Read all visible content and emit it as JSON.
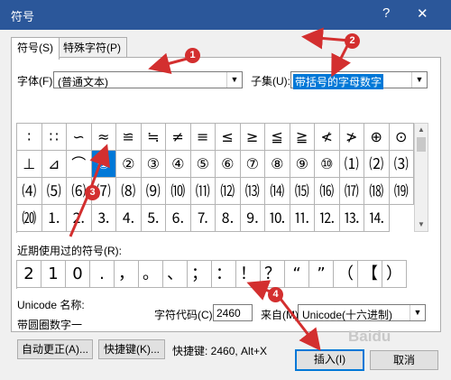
{
  "window": {
    "title": "符号",
    "help": "?",
    "close": "✕"
  },
  "tabs": [
    {
      "label": "符号(S)"
    },
    {
      "label": "特殊字符(P)"
    }
  ],
  "font": {
    "label": "字体(F):",
    "value": "(普通文本)"
  },
  "subset": {
    "label": "子集(U):",
    "value": "带括号的字母数字"
  },
  "symbols": [
    [
      "∶",
      "∷",
      "∽",
      "≈",
      "≌",
      "≒",
      "≠",
      "≡",
      "≤",
      "≥",
      "≦",
      "≧",
      "≮",
      "≯",
      "⊕",
      "⊙"
    ],
    [
      "⊥",
      "⊿",
      "⌒",
      "①",
      "②",
      "③",
      "④",
      "⑤",
      "⑥",
      "⑦",
      "⑧",
      "⑨",
      "⑩",
      "⑴",
      "⑵",
      "⑶"
    ],
    [
      "⑷",
      "⑸",
      "⑹",
      "⑺",
      "⑻",
      "⑼",
      "⑽",
      "⑾",
      "⑿",
      "⒀",
      "⒁",
      "⒂",
      "⒃",
      "⒄",
      "⒅",
      "⒆"
    ],
    [
      "⒇",
      "⒈",
      "⒉",
      "⒊",
      "⒋",
      "⒌",
      "⒍",
      "⒎",
      "⒏",
      "⒐",
      "⒑",
      "⒒",
      "⒓",
      "⒔",
      "⒕"
    ]
  ],
  "recent_label": "近期使用过的符号(R):",
  "recent_symbols": [
    "2",
    "1",
    "0",
    ".",
    "，",
    "。",
    "、",
    "；",
    "：",
    "！",
    "？",
    "“",
    "”",
    "（",
    "【",
    "）"
  ],
  "unicode_name_label": "Unicode 名称:",
  "unicode_name": "带圆圈数字一",
  "char_code_label": "字符代码(C):",
  "char_code": "2460",
  "from_label": "来自(M):",
  "from_value": "Unicode(十六进制)",
  "autocorrect_button": "自动更正(A)...",
  "shortcut_button": "快捷键(K)...",
  "shortcut_text": "快捷键: 2460, Alt+X",
  "insert_button": "插入(I)",
  "cancel_button": "取消",
  "annotations": [
    "1",
    "2",
    "3",
    "4"
  ],
  "colors": {
    "titlebar": "#2b579a",
    "selection": "#0078d7",
    "annotation": "#d32f2f"
  }
}
